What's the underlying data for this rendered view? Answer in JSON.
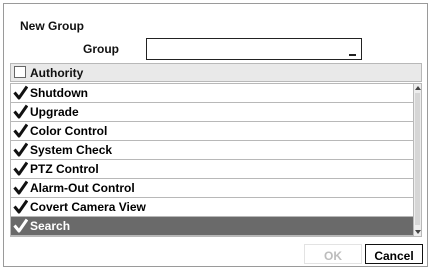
{
  "dialog": {
    "title": "New Group",
    "group_label": "Group",
    "group_value": ""
  },
  "list": {
    "header_label": "Authority",
    "header_checked": false,
    "items": [
      {
        "label": "Shutdown",
        "checked": true,
        "selected": false
      },
      {
        "label": "Upgrade",
        "checked": true,
        "selected": false
      },
      {
        "label": "Color Control",
        "checked": true,
        "selected": false
      },
      {
        "label": "System Check",
        "checked": true,
        "selected": false
      },
      {
        "label": "PTZ Control",
        "checked": true,
        "selected": false
      },
      {
        "label": "Alarm-Out Control",
        "checked": true,
        "selected": false
      },
      {
        "label": "Covert Camera View",
        "checked": true,
        "selected": false
      },
      {
        "label": "Search",
        "checked": true,
        "selected": true
      }
    ]
  },
  "buttons": {
    "ok": "OK",
    "cancel": "Cancel"
  },
  "colors": {
    "selected_row": "#6a6a6a",
    "border": "#b8b8b8",
    "disabled_text": "#bdbdbd"
  }
}
